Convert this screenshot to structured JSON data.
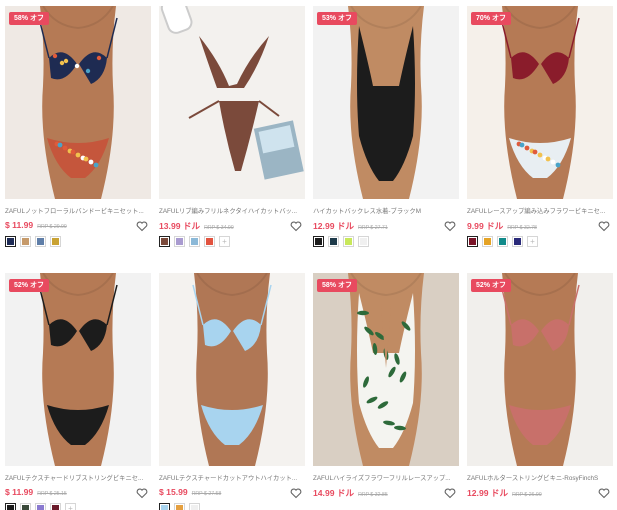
{
  "products": [
    {
      "badge": "58% オフ",
      "title": "ZAFULノットフローラルバンドービキニセット...",
      "price": "$ 11.99",
      "rrp": "RRP $ 29.99",
      "bg": "#efe9e4",
      "skin": "#b57a55",
      "suit": "#1e2b52",
      "suit2": "#c5563c",
      "pattern": "floral",
      "model": "bikini",
      "swatches": [
        "#1d2a55",
        "#c69a6a",
        "#5f7ea8",
        "#c9a233"
      ],
      "swatches_plus": false
    },
    {
      "badge": "",
      "title": "ZAFULリブ編みフリルネクタイハイカットバッ...",
      "price": "13.99 ドル",
      "rrp": "RRP $ 34.99",
      "bg": "#f3f1ee",
      "skin": "#b57a55",
      "suit": "#7b4a3b",
      "suit2": "#7b4a3b",
      "pattern": "solid",
      "model": "flatlay",
      "swatches": [
        "#7b4a3b",
        "#a99bd0",
        "#8cb9d8",
        "#e2533f"
      ],
      "swatches_plus": true
    },
    {
      "badge": "53% オフ",
      "title": "ハイカットバックレス水着-ブラックM",
      "price": "12.99 ドル",
      "rrp": "RRP $ 27.71",
      "bg": "#f2f2f2",
      "skin": "#c08b63",
      "suit": "#1c1c1c",
      "suit2": "#1c1c1c",
      "pattern": "solid",
      "model": "onepiece",
      "swatches": [
        "#1c1c1c",
        "#1e3a4a",
        "#c8e85a",
        "#f0f0f0"
      ],
      "swatches_plus": false
    },
    {
      "badge": "70% オフ",
      "title": "ZAFULレースアップ編み込みフラワービキニセ...",
      "price": "9.99 ドル",
      "rrp": "RRP $ 32.78",
      "bg": "#f5f0ea",
      "skin": "#b57a55",
      "suit": "#8a1c2b",
      "suit2": "#e8eef2",
      "pattern": "floralbottom",
      "model": "bikini",
      "swatches": [
        "#7a1428",
        "#e5a325",
        "#118a8a",
        "#2a2a7a"
      ],
      "swatches_plus": true
    },
    {
      "badge": "52% オフ",
      "title": "ZAFULテクスチャードリブストリングビキニセ...",
      "price": "$ 11.99",
      "rrp": "RRP $ 25.15",
      "bg": "#f2f2f2",
      "skin": "#b57a55",
      "suit": "#1c1c1c",
      "suit2": "#1c1c1c",
      "pattern": "solid",
      "model": "bikini",
      "swatches": [
        "#1c1c1c",
        "#3a4a3a",
        "#8a7ad0",
        "#6a1a2a"
      ],
      "swatches_plus": true
    },
    {
      "badge": "",
      "title": "ZAFULテクスチャードカットアウトハイカット...",
      "price": "$ 15.99",
      "rrp": "RRP $ 27.58",
      "bg": "#f4f2ef",
      "skin": "#b07755",
      "suit": "#a8d4ef",
      "suit2": "#a8d4ef",
      "pattern": "solid",
      "model": "bikini",
      "swatches": [
        "#a8d4ef",
        "#e5a040",
        "#f0f0f0"
      ],
      "swatches_plus": false
    },
    {
      "badge": "58% オフ",
      "title": "ZAFULハイライズフラワーフリルレースアップ...",
      "price": "14.99 ドル",
      "rrp": "RRP $ 32.85",
      "bg": "#d9cfc3",
      "skin": "#c08b63",
      "suit": "#f4f4f0",
      "suit2": "#2d6a3a",
      "pattern": "leaves",
      "model": "onepiece",
      "swatches": [],
      "swatches_plus": false
    },
    {
      "badge": "52% オフ",
      "title": "ZAFULホルターストリングビキニ-RosyFinchS",
      "price": "12.99 ドル",
      "rrp": "RRP $ 26.99",
      "bg": "#f1efec",
      "skin": "#b57a55",
      "suit": "#c8706a",
      "suit2": "#c8706a",
      "pattern": "solid",
      "model": "bikini",
      "swatches": [],
      "swatches_plus": false
    }
  ]
}
